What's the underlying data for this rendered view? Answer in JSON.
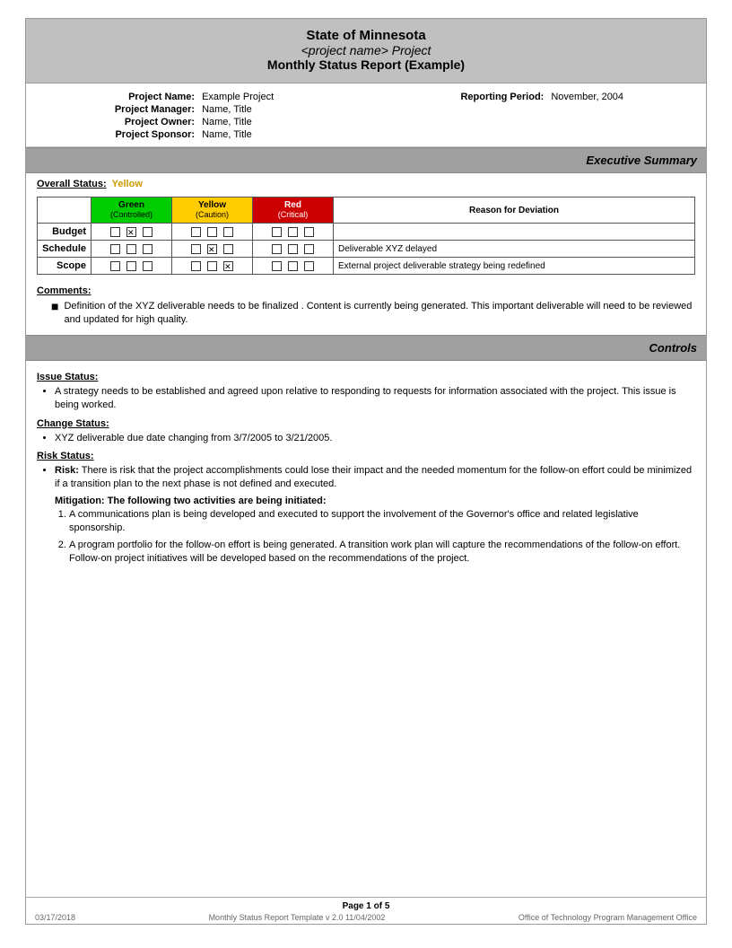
{
  "header": {
    "state": "State of Minnesota",
    "project_name": "<project name> Project",
    "report_title": "Monthly Status Report (Example)"
  },
  "project_info": {
    "project_name_label": "Project Name:",
    "project_name_value": "Example Project",
    "reporting_period_label": "Reporting Period:",
    "reporting_period_value": "November, 2004",
    "project_manager_label": "Project Manager:",
    "project_manager_value": "Name, Title",
    "project_owner_label": "Project Owner:",
    "project_owner_value": "Name, Title",
    "project_sponsor_label": "Project Sponsor:",
    "project_sponsor_value": "Name, Title"
  },
  "executive_summary": {
    "section_title": "Executive Summary",
    "overall_status_label": "Overall Status:",
    "overall_status_value": "Yellow",
    "table": {
      "col_green_label": "Green",
      "col_green_sub": "(Controlled)",
      "col_yellow_label": "Yellow",
      "col_yellow_sub": "(Caution)",
      "col_red_label": "Red",
      "col_red_sub": "(Critical)",
      "col_reason": "Reason for Deviation",
      "rows": [
        {
          "label": "Budget",
          "green": [
            false,
            true,
            false
          ],
          "yellow": [
            false,
            false,
            false
          ],
          "red": [
            false,
            false,
            false
          ],
          "reason": ""
        },
        {
          "label": "Schedule",
          "green": [
            false,
            false,
            false
          ],
          "yellow": [
            false,
            true,
            false
          ],
          "red": [
            false,
            false,
            false
          ],
          "reason": "Deliverable XYZ delayed"
        },
        {
          "label": "Scope",
          "green": [
            false,
            false,
            false
          ],
          "yellow": [
            false,
            false,
            true
          ],
          "red": [
            false,
            false,
            false
          ],
          "reason": "External project deliverable strategy being redefined"
        }
      ]
    },
    "comments_label": "Comments:",
    "comment": "Definition of the XYZ deliverable  needs to be finalized .  Content is currently being generated.  This important deliverable will need to be reviewed and updated for high quality."
  },
  "controls": {
    "section_title": "Controls",
    "issue_status_label": "Issue Status:",
    "issue_bullet": "A strategy needs to be established and agreed upon relative to  responding to  requests for information associated with the project.  This issue is being worked.",
    "change_status_label": "Change Status:",
    "change_bullet": "XYZ  deliverable due date changing from   3/7/2005 to 3/21/2005.",
    "risk_status_label": "Risk Status:",
    "risk_bullet_bold": "Risk:",
    "risk_bullet_text": " There is risk that the project accomplishments could lose their impact and the needed momentum for the follow-on effort could be   minimized if a transition plan to the next phase is not defined and executed.",
    "mitigation_label": "Mitigation:",
    "mitigation_intro": " The following two activities are being initiated:",
    "mitigation_items": [
      "A communications plan is being developed and executed to support the involvement of the Governor's office and related legislative sponsorship.",
      "A program portfolio for the follow-on effort is being generated.  A transition work plan will capture the recommendations of the follow-on effort. Follow-on project initiatives will be developed based on the recommendations of the project."
    ]
  },
  "footer": {
    "date": "03/17/2018",
    "page": "Page 1 of 5",
    "template_info": "Monthly Status Report Template  v 2.0  11/04/2002",
    "office": "Office of Technology Program Management Office"
  }
}
